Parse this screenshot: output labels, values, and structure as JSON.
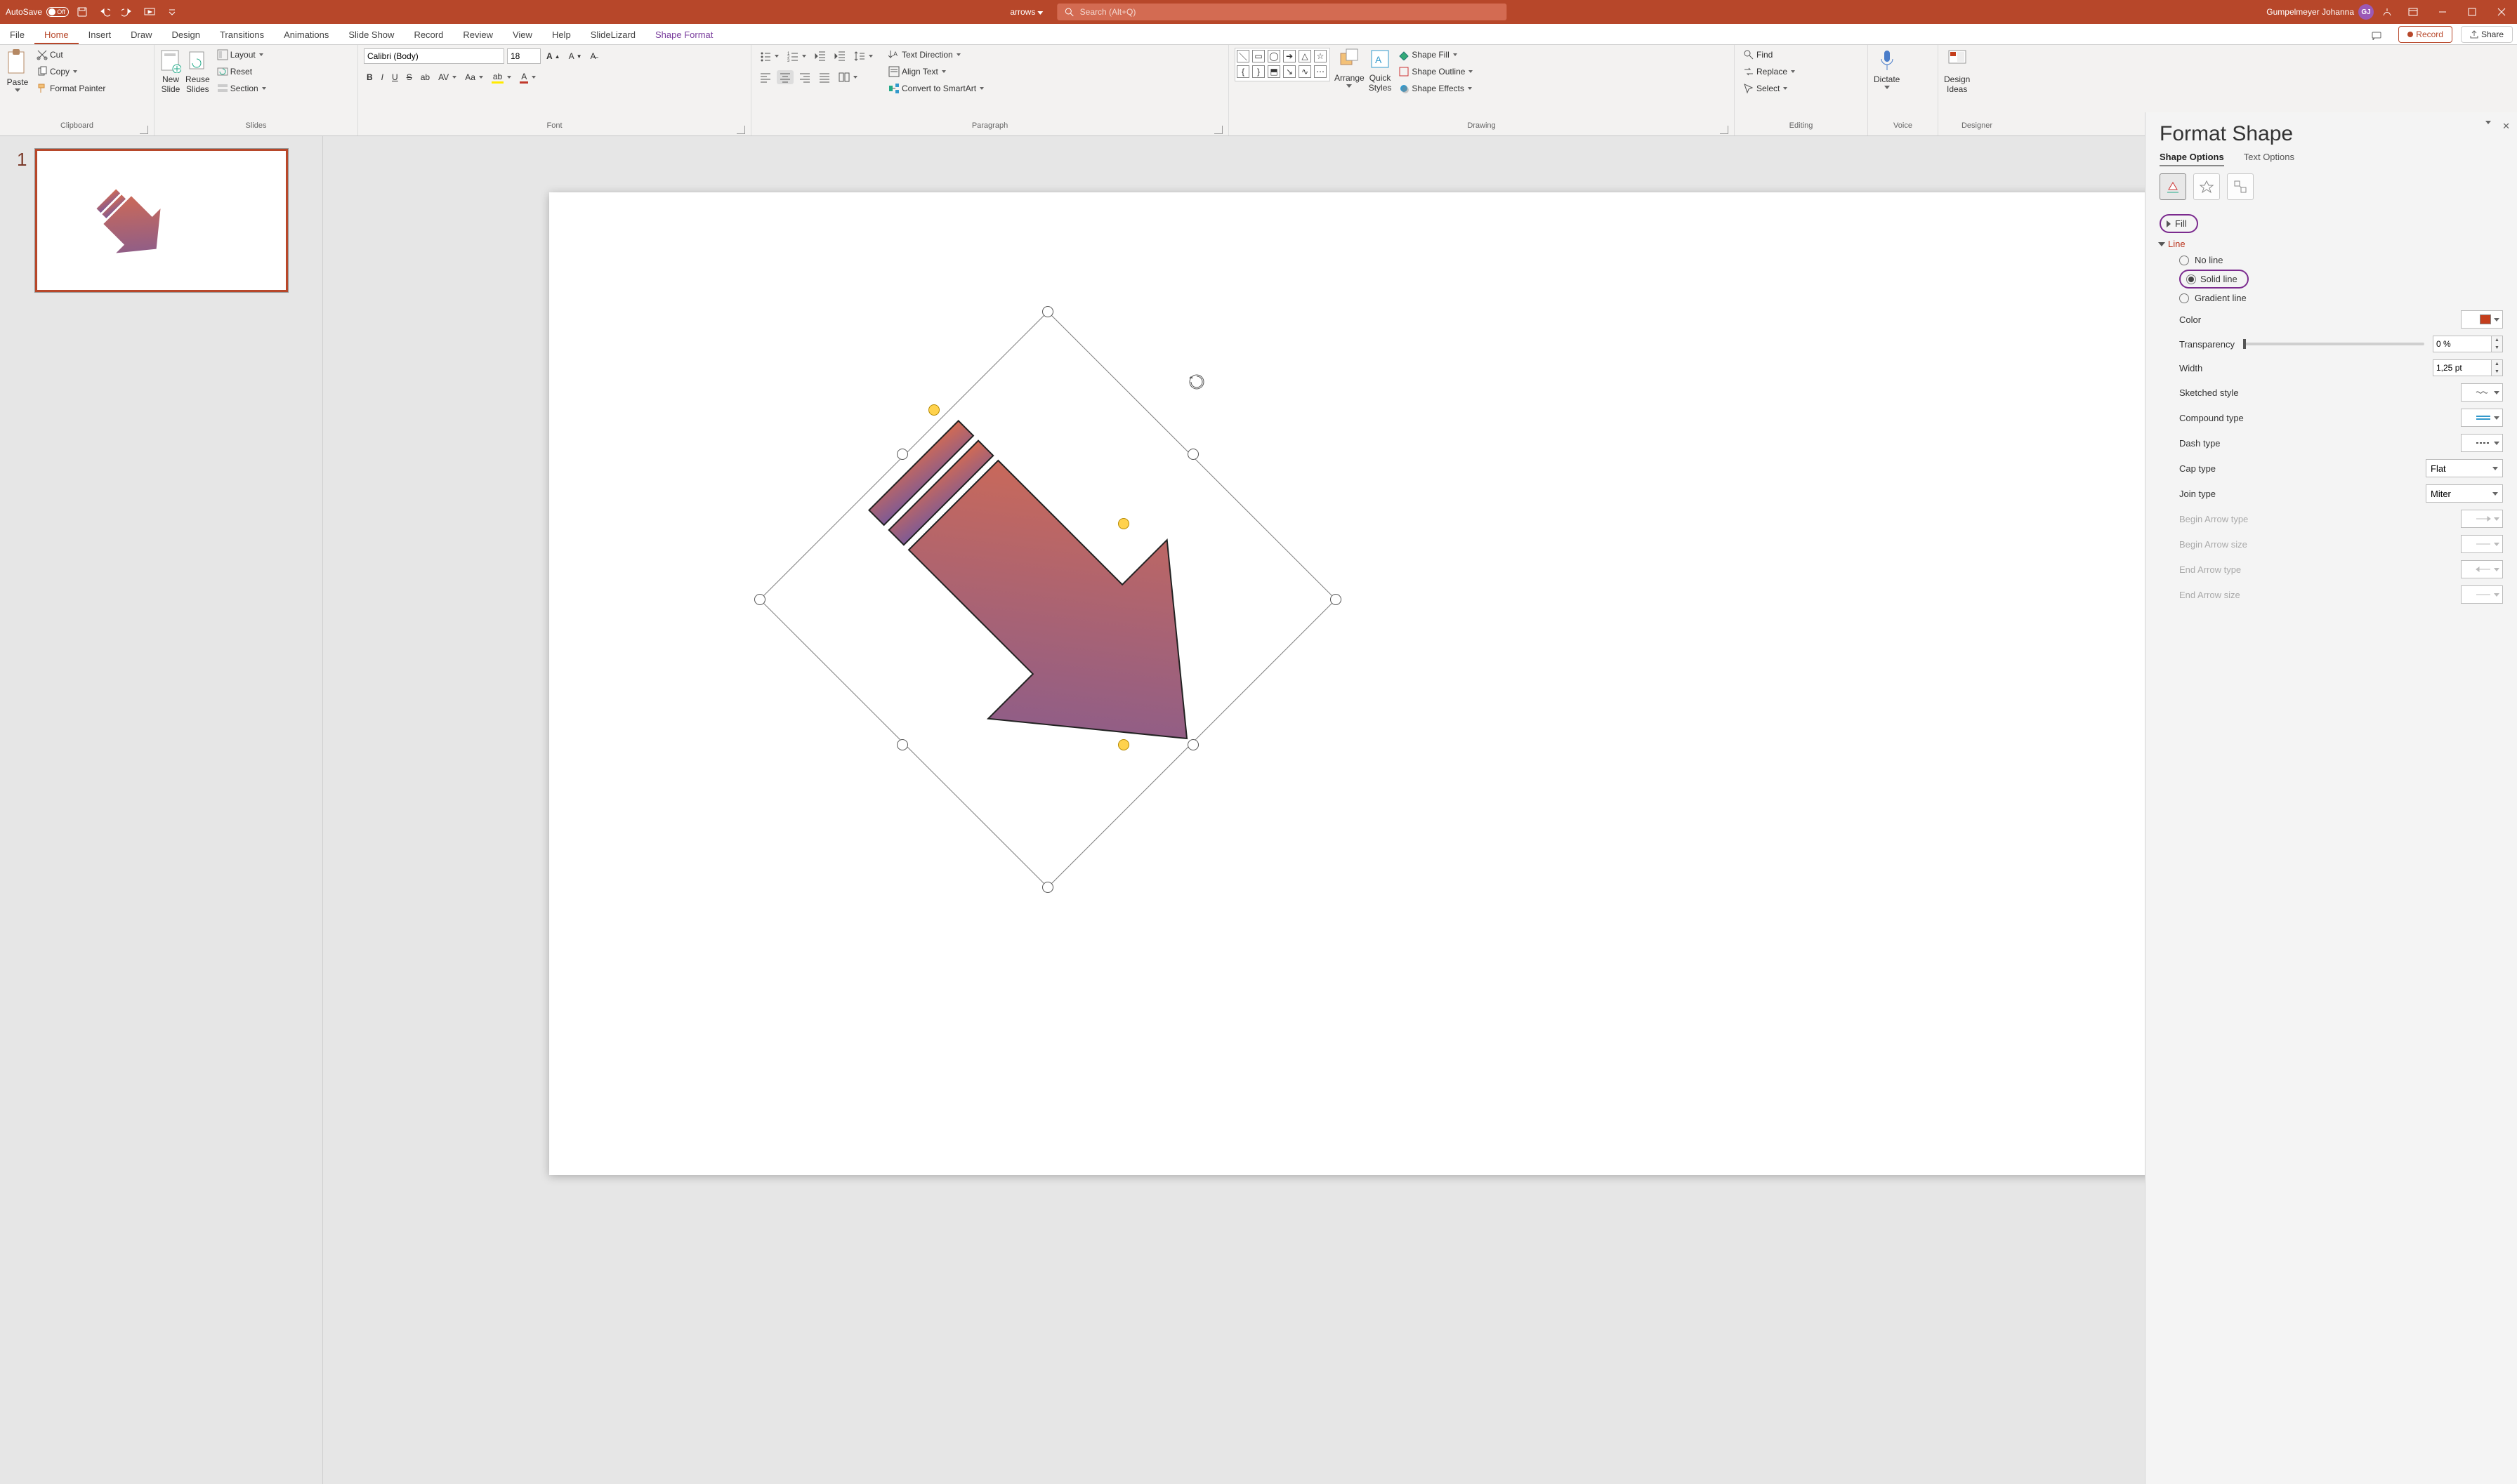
{
  "title_bar": {
    "autosave_label": "AutoSave",
    "autosave_off": "Off",
    "filename": "arrows",
    "search_placeholder": "Search (Alt+Q)",
    "user_name": "Gumpelmeyer Johanna",
    "user_initials": "GJ"
  },
  "tabs": {
    "items": [
      "File",
      "Home",
      "Insert",
      "Draw",
      "Design",
      "Transitions",
      "Animations",
      "Slide Show",
      "Record",
      "Review",
      "View",
      "Help",
      "SlideLizard",
      "Shape Format"
    ],
    "active_index": 1,
    "comments": "Comments",
    "record": "Record",
    "share": "Share"
  },
  "ribbon": {
    "clipboard": {
      "label": "Clipboard",
      "paste": "Paste",
      "cut": "Cut",
      "copy": "Copy",
      "format_painter": "Format Painter"
    },
    "slides": {
      "label": "Slides",
      "new_slide": "New\nSlide",
      "reuse": "Reuse\nSlides",
      "layout": "Layout",
      "reset": "Reset",
      "section": "Section"
    },
    "font": {
      "label": "Font",
      "name": "Calibri (Body)",
      "size": "18"
    },
    "paragraph": {
      "label": "Paragraph",
      "text_direction": "Text Direction",
      "align_text": "Align Text",
      "smartart": "Convert to SmartArt"
    },
    "drawing": {
      "label": "Drawing",
      "arrange": "Arrange",
      "quick_styles": "Quick\nStyles",
      "shape_fill": "Shape Fill",
      "shape_outline": "Shape Outline",
      "shape_effects": "Shape Effects"
    },
    "editing": {
      "label": "Editing",
      "find": "Find",
      "replace": "Replace",
      "select": "Select"
    },
    "voice": {
      "label": "Voice",
      "dictate": "Dictate"
    },
    "designer": {
      "label": "Designer",
      "ideas": "Design\nIdeas"
    }
  },
  "thumb": {
    "number": "1"
  },
  "pane": {
    "title": "Format Shape",
    "tabs": {
      "shape": "Shape Options",
      "text": "Text Options",
      "active": "shape"
    },
    "sections": {
      "fill": "Fill",
      "line": "Line"
    },
    "line": {
      "no_line": "No line",
      "solid_line": "Solid line",
      "gradient_line": "Gradient line",
      "selected": "solid",
      "color": "Color",
      "transparency": "Transparency",
      "transparency_value": "0 %",
      "width": "Width",
      "width_value": "1,25 pt",
      "sketched": "Sketched style",
      "compound": "Compound type",
      "dash": "Dash type",
      "cap": "Cap type",
      "cap_value": "Flat",
      "join": "Join type",
      "join_value": "Miter",
      "begin_type": "Begin Arrow type",
      "begin_size": "Begin Arrow size",
      "end_type": "End Arrow type",
      "end_size": "End Arrow size"
    }
  },
  "colors": {
    "arrow_start": "#d36b52",
    "arrow_end": "#7d5a96"
  }
}
